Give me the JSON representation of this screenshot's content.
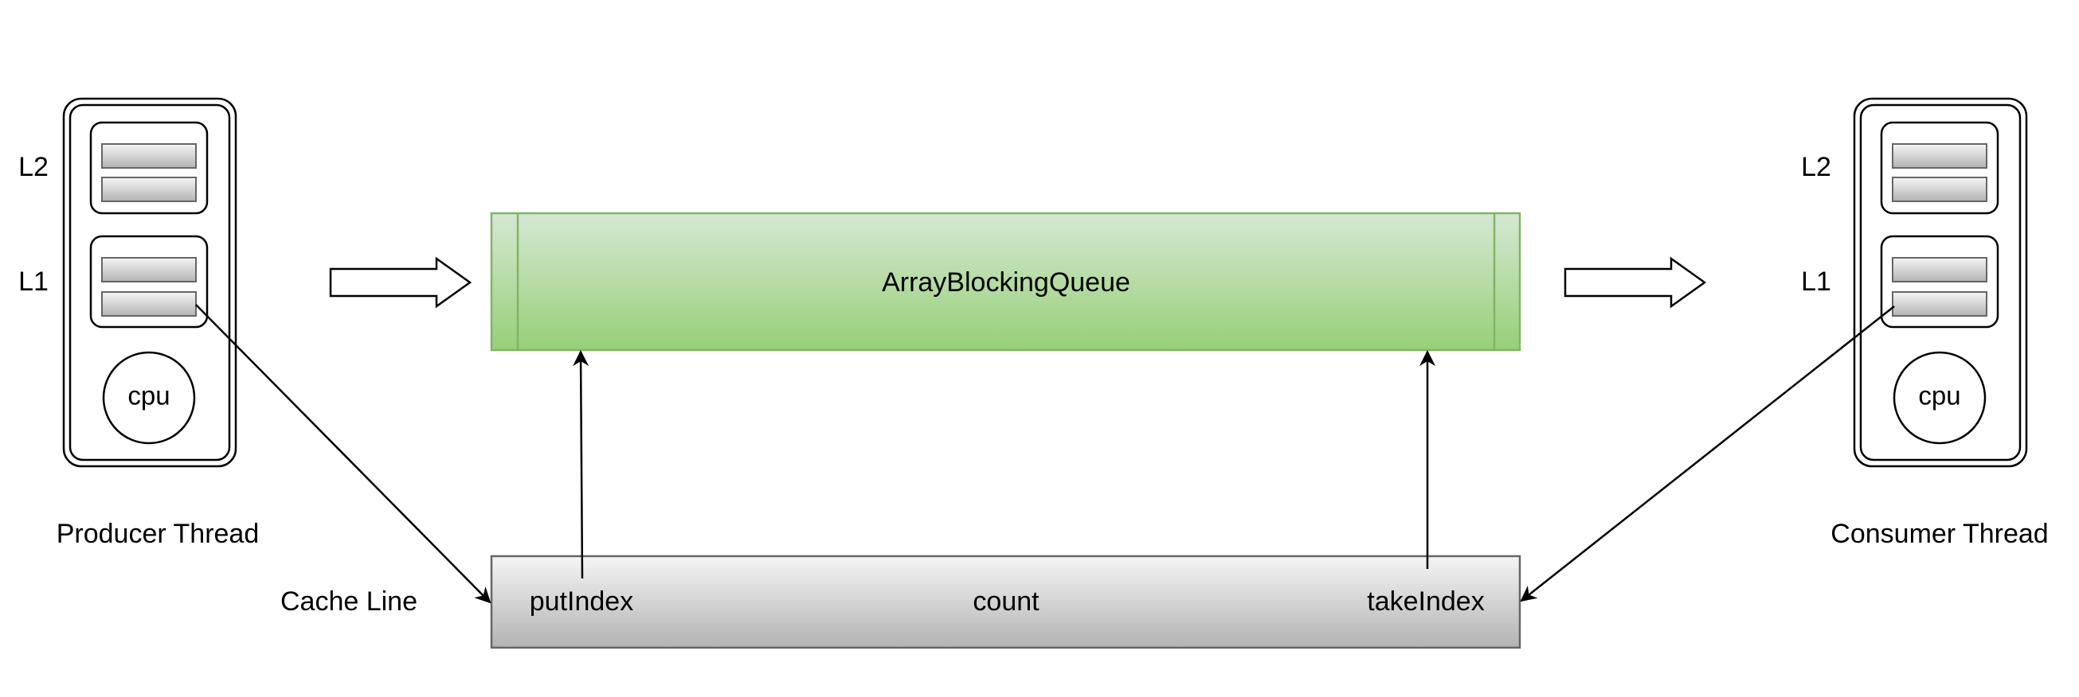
{
  "queue": {
    "label": "ArrayBlockingQueue"
  },
  "cache_line": {
    "label": "Cache Line",
    "fields": [
      "putIndex",
      "count",
      "takeIndex"
    ]
  },
  "producer": {
    "label": "Producer Thread",
    "cache_levels": [
      "L2",
      "L1"
    ],
    "cpu_label": "cpu"
  },
  "consumer": {
    "label": "Consumer Thread",
    "cache_levels": [
      "L2",
      "L1"
    ],
    "cpu_label": "cpu"
  },
  "colors": {
    "queue_fill_top": "#d5e8d4",
    "queue_fill_bottom": "#97d077",
    "queue_stroke": "#82b366",
    "cache_fill_top": "#f5f5f5",
    "cache_fill_bottom": "#b3b3b3",
    "cache_stroke": "#666666",
    "line": "#000000"
  }
}
